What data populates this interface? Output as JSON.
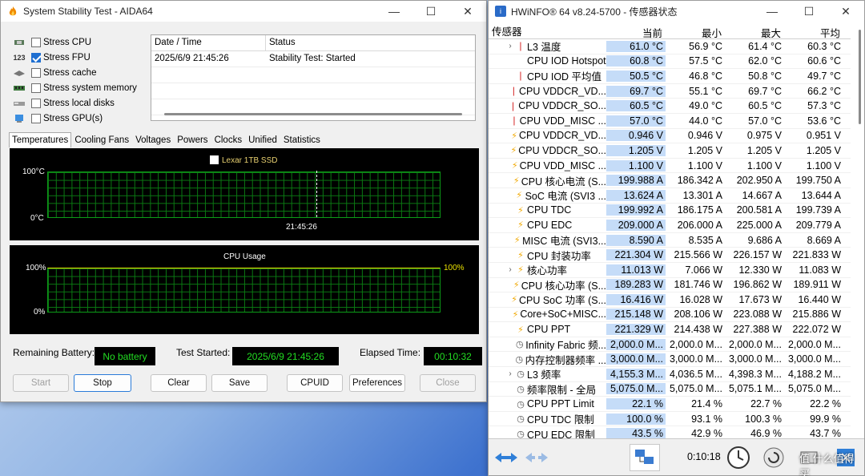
{
  "aida": {
    "title": "System Stability Test - AIDA64",
    "stress": [
      {
        "label": "Stress CPU",
        "checked": false,
        "icon": "cpu-chip-icon"
      },
      {
        "label": "Stress FPU",
        "checked": true,
        "icon": "fpu-123-icon"
      },
      {
        "label": "Stress cache",
        "checked": false,
        "icon": "cache-icon"
      },
      {
        "label": "Stress system memory",
        "checked": false,
        "icon": "memory-icon"
      },
      {
        "label": "Stress local disks",
        "checked": false,
        "icon": "disk-icon"
      },
      {
        "label": "Stress GPU(s)",
        "checked": false,
        "icon": "gpu-icon"
      }
    ],
    "log": {
      "headers": [
        "Date / Time",
        "Status"
      ],
      "rows": [
        [
          "2025/6/9 21:45:26",
          "Stability Test: Started"
        ]
      ]
    },
    "tabs": [
      "Temperatures",
      "Cooling Fans",
      "Voltages",
      "Powers",
      "Clocks",
      "Unified",
      "Statistics"
    ],
    "temp_graph": {
      "legend": "Lexar 1TB SSD",
      "ymax": "100°C",
      "ymin": "0°C",
      "time": "21:45:26"
    },
    "cpu_graph": {
      "title": "CPU Usage",
      "ymax": "100%",
      "ymin": "0%",
      "value": "100%"
    },
    "remaining_battery_label": "Remaining Battery:",
    "remaining_battery_value": "No battery",
    "test_started_label": "Test Started:",
    "test_started_value": "2025/6/9 21:45:26",
    "elapsed_label": "Elapsed Time:",
    "elapsed_value": "00:10:32",
    "buttons": {
      "start": "Start",
      "stop": "Stop",
      "clear": "Clear",
      "save": "Save",
      "cpuid": "CPUID",
      "preferences": "Preferences",
      "close": "Close"
    }
  },
  "hw": {
    "title": "HWiNFO® 64 v8.24-5700 - 传感器状态",
    "headers": [
      "传感器",
      "当前",
      "最小",
      "最大",
      "平均"
    ],
    "rows": [
      {
        "icon": "therm",
        "expand": true,
        "name": "L3 温度",
        "v": [
          "61.0 °C",
          "56.9 °C",
          "61.4 °C",
          "60.3 °C"
        ]
      },
      {
        "icon": "none",
        "expand": false,
        "name": "CPU IOD Hotspot",
        "v": [
          "60.8 °C",
          "57.5 °C",
          "62.0 °C",
          "60.6 °C"
        ]
      },
      {
        "icon": "therm",
        "expand": false,
        "name": "CPU IOD 平均值",
        "v": [
          "50.5 °C",
          "46.8 °C",
          "50.8 °C",
          "49.7 °C"
        ]
      },
      {
        "icon": "therm",
        "expand": false,
        "name": "CPU VDDCR_VD...",
        "v": [
          "69.7 °C",
          "55.1 °C",
          "69.7 °C",
          "66.2 °C"
        ]
      },
      {
        "icon": "therm",
        "expand": false,
        "name": "CPU VDDCR_SO...",
        "v": [
          "60.5 °C",
          "49.0 °C",
          "60.5 °C",
          "57.3 °C"
        ]
      },
      {
        "icon": "therm",
        "expand": false,
        "name": "CPU VDD_MISC ...",
        "v": [
          "57.0 °C",
          "44.0 °C",
          "57.0 °C",
          "53.6 °C"
        ]
      },
      {
        "icon": "volt",
        "expand": false,
        "name": "CPU VDDCR_VD...",
        "v": [
          "0.946 V",
          "0.946 V",
          "0.975 V",
          "0.951 V"
        ]
      },
      {
        "icon": "volt",
        "expand": false,
        "name": "CPU VDDCR_SO...",
        "v": [
          "1.205 V",
          "1.205 V",
          "1.205 V",
          "1.205 V"
        ]
      },
      {
        "icon": "volt",
        "expand": false,
        "name": "CPU VDD_MISC ...",
        "v": [
          "1.100 V",
          "1.100 V",
          "1.100 V",
          "1.100 V"
        ]
      },
      {
        "icon": "volt",
        "expand": false,
        "name": "CPU 核心电流 (S...",
        "v": [
          "199.988 A",
          "186.342 A",
          "202.950 A",
          "199.750 A"
        ]
      },
      {
        "icon": "volt",
        "expand": false,
        "name": "SoC 电流 (SVI3 ...",
        "v": [
          "13.624 A",
          "13.301 A",
          "14.667 A",
          "13.644 A"
        ]
      },
      {
        "icon": "volt",
        "expand": false,
        "name": "CPU TDC",
        "v": [
          "199.992 A",
          "186.175 A",
          "200.581 A",
          "199.739 A"
        ]
      },
      {
        "icon": "volt",
        "expand": false,
        "name": "CPU EDC",
        "v": [
          "209.000 A",
          "206.000 A",
          "225.000 A",
          "209.779 A"
        ]
      },
      {
        "icon": "volt",
        "expand": false,
        "name": "MISC 电流 (SVI3...",
        "v": [
          "8.590 A",
          "8.535 A",
          "9.686 A",
          "8.669 A"
        ]
      },
      {
        "icon": "volt",
        "expand": false,
        "name": "CPU 封装功率",
        "v": [
          "221.304 W",
          "215.566 W",
          "226.157 W",
          "221.833 W"
        ]
      },
      {
        "icon": "volt",
        "expand": true,
        "name": "核心功率",
        "v": [
          "11.013 W",
          "7.066 W",
          "12.330 W",
          "11.083 W"
        ]
      },
      {
        "icon": "volt",
        "expand": false,
        "name": "CPU 核心功率 (S...",
        "v": [
          "189.283 W",
          "181.746 W",
          "196.862 W",
          "189.911 W"
        ]
      },
      {
        "icon": "volt",
        "expand": false,
        "name": "CPU SoC 功率 (S...",
        "v": [
          "16.416 W",
          "16.028 W",
          "17.673 W",
          "16.440 W"
        ]
      },
      {
        "icon": "volt",
        "expand": false,
        "name": "Core+SoC+MISC...",
        "v": [
          "215.148 W",
          "208.106 W",
          "223.088 W",
          "215.886 W"
        ]
      },
      {
        "icon": "volt",
        "expand": false,
        "name": "CPU PPT",
        "v": [
          "221.329 W",
          "214.438 W",
          "227.388 W",
          "222.072 W"
        ]
      },
      {
        "icon": "clock",
        "expand": false,
        "name": "Infinity Fabric 频...",
        "v": [
          "2,000.0 M...",
          "2,000.0 M...",
          "2,000.0 M...",
          "2,000.0 M..."
        ]
      },
      {
        "icon": "clock",
        "expand": false,
        "name": "内存控制器频率 ...",
        "v": [
          "3,000.0 M...",
          "3,000.0 M...",
          "3,000.0 M...",
          "3,000.0 M..."
        ]
      },
      {
        "icon": "clock",
        "expand": true,
        "name": "L3 频率",
        "v": [
          "4,155.3 M...",
          "4,036.5 M...",
          "4,398.3 M...",
          "4,188.2 M..."
        ]
      },
      {
        "icon": "clock",
        "expand": false,
        "name": "频率限制 - 全局",
        "v": [
          "5,075.0 M...",
          "5,075.0 M...",
          "5,075.1 M...",
          "5,075.0 M..."
        ]
      },
      {
        "icon": "clock",
        "expand": false,
        "name": "CPU PPT Limit",
        "v": [
          "22.1 %",
          "21.4 %",
          "22.7 %",
          "22.2 %"
        ]
      },
      {
        "icon": "clock",
        "expand": false,
        "name": "CPU TDC 限制",
        "v": [
          "100.0 %",
          "93.1 %",
          "100.3 %",
          "99.9 %"
        ]
      },
      {
        "icon": "clock",
        "expand": false,
        "name": "CPU EDC 限制",
        "v": [
          "43.5 %",
          "42.9 %",
          "46.9 %",
          "43.7 %"
        ]
      }
    ],
    "status_time": "0:10:18",
    "watermark": "值 什么值得买"
  }
}
